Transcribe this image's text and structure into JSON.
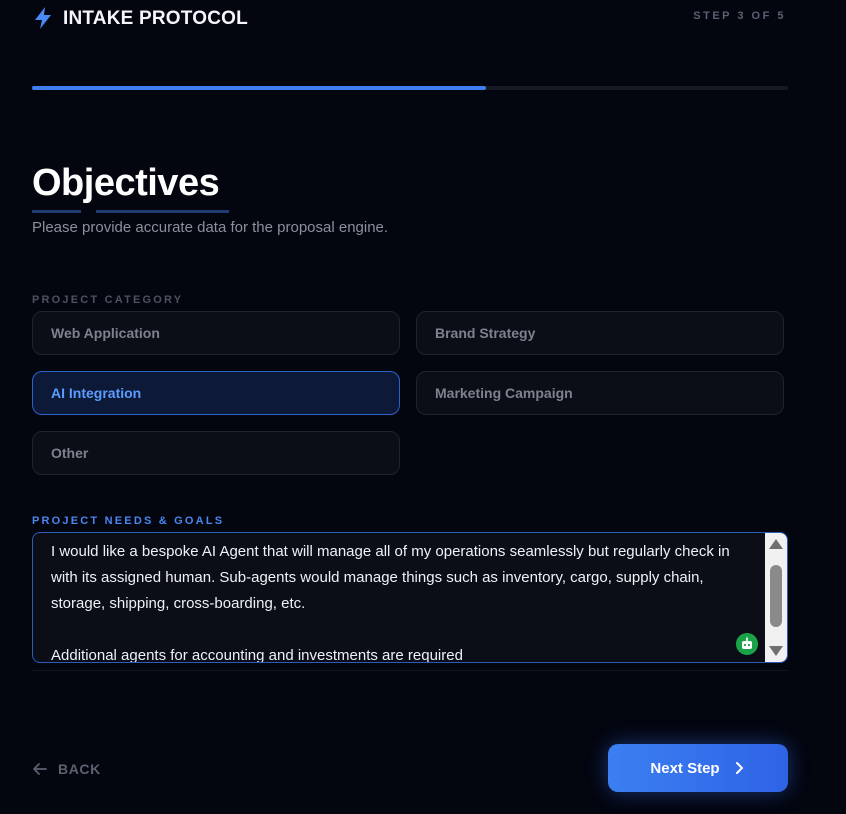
{
  "header": {
    "title": "INTAKE PROTOCOL",
    "step": "STEP 3 OF 5",
    "logo_icon": "lightning-bolt-icon",
    "accent": "#3d7ff0"
  },
  "progress": {
    "current": 3,
    "total": 5,
    "fraction": 0.6
  },
  "main": {
    "title": "Objectives",
    "subtitle": "Please provide accurate data for the proposal engine."
  },
  "category": {
    "label": "PROJECT CATEGORY",
    "selected": "AI Integration",
    "options": [
      "Web Application",
      "Brand Strategy",
      "AI Integration",
      "Marketing Campaign",
      "Other"
    ]
  },
  "needs": {
    "label": "PROJECT NEEDS & GOALS",
    "value": "I would like a bespoke AI Agent that will manage all of my operations seamlessly but regularly check in with its assigned human. Sub-agents would manage things such as inventory, cargo, supply chain, storage, shipping, cross-boarding, etc.\n\nAdditional agents for accounting and investments are required",
    "assist_icon": "robot-icon"
  },
  "footer": {
    "back_label": "BACK",
    "next_label": "Next Step"
  }
}
